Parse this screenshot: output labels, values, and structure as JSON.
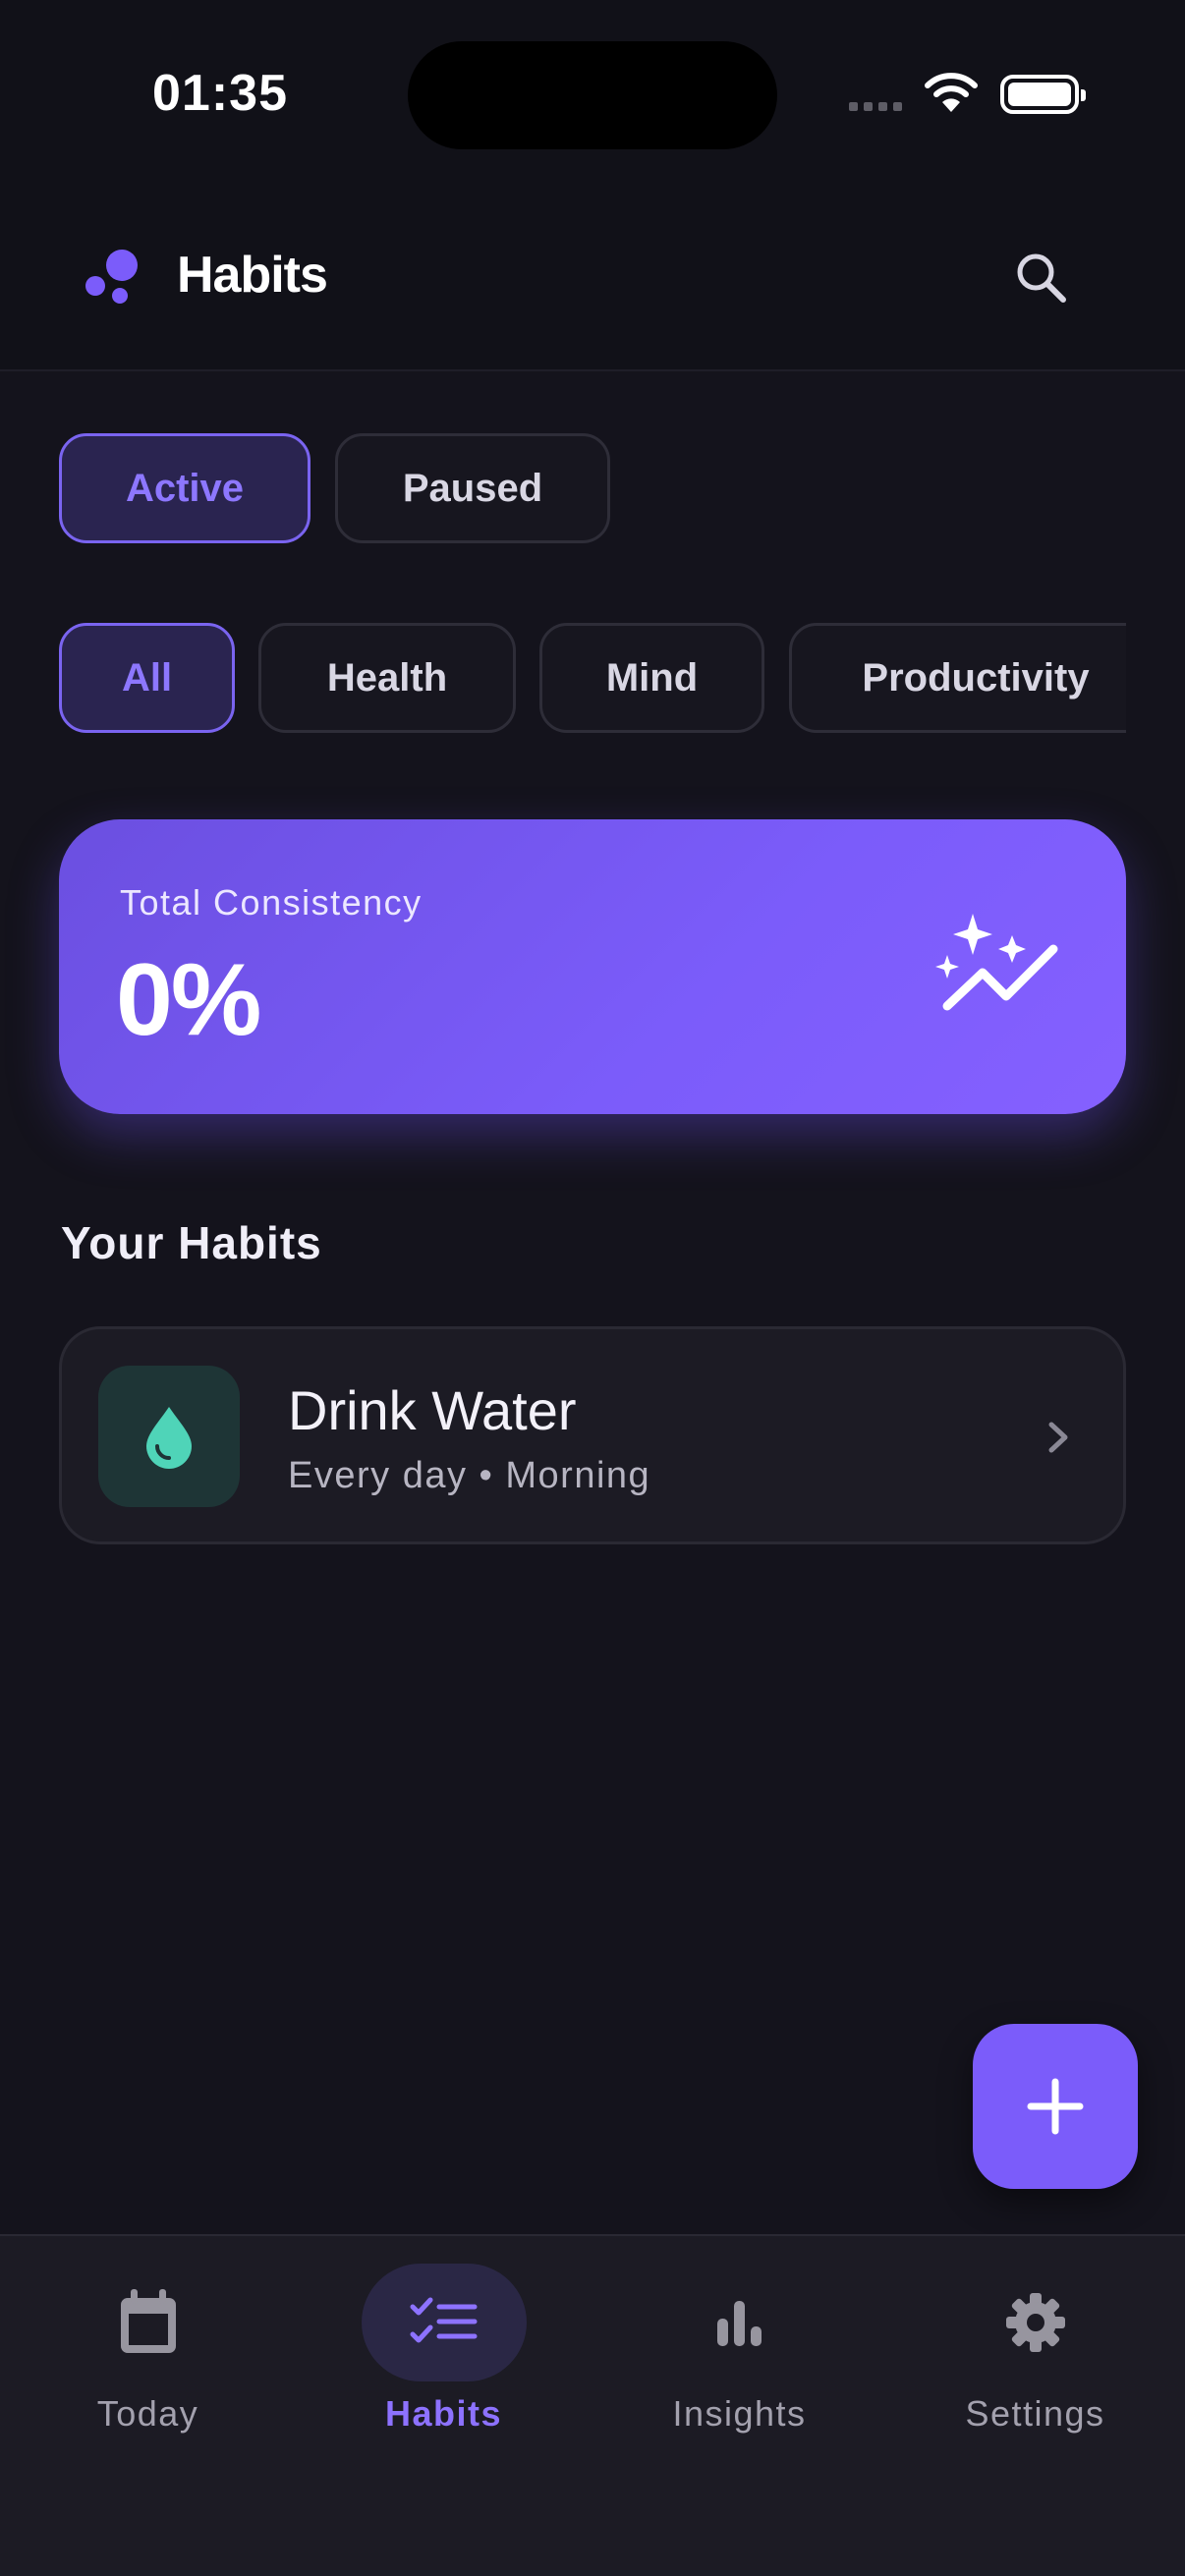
{
  "status_bar": {
    "time": "01:35",
    "icons": [
      "cellular-signal-icon",
      "wifi-icon",
      "battery-icon"
    ]
  },
  "app_bar": {
    "title": "Habits",
    "logo_icon": "dots-logo-icon",
    "search_icon": "search-icon"
  },
  "state_tabs": [
    {
      "label": "Active",
      "selected": true
    },
    {
      "label": "Paused",
      "selected": false
    }
  ],
  "category_chips": [
    {
      "label": "All",
      "selected": true
    },
    {
      "label": "Health",
      "selected": false
    },
    {
      "label": "Mind",
      "selected": false
    },
    {
      "label": "Productivity",
      "selected": false
    }
  ],
  "consistency_card": {
    "label": "Total Consistency",
    "value": "0%",
    "icon": "sparkle-trend-icon"
  },
  "habits_section": {
    "title": "Your Habits",
    "items": [
      {
        "name": "Drink Water",
        "meta": "Every day • Morning",
        "icon": "water-drop-icon",
        "icon_color": "#4fd4b8"
      }
    ]
  },
  "fab": {
    "icon": "plus-icon"
  },
  "bottom_nav": [
    {
      "label": "Today",
      "icon": "calendar-icon",
      "selected": false
    },
    {
      "label": "Habits",
      "icon": "checklist-icon",
      "selected": true
    },
    {
      "label": "Insights",
      "icon": "bar-chart-icon",
      "selected": false
    },
    {
      "label": "Settings",
      "icon": "gear-icon",
      "selected": false
    }
  ],
  "colors": {
    "background": "#14131c",
    "accent": "#7b5cfa",
    "accent_text": "#8d72ff",
    "card": "#1c1b24",
    "water_teal": "#4fd4b8"
  }
}
